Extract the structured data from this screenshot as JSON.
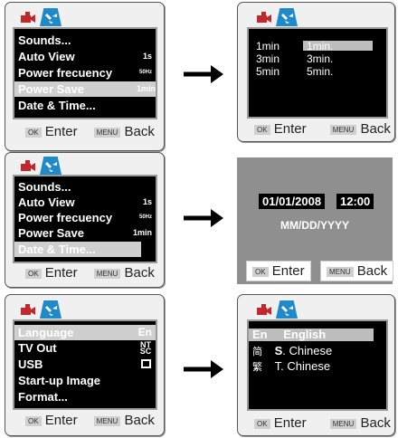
{
  "panel1": {
    "items": [
      {
        "label": "Sounds...",
        "value": ""
      },
      {
        "label": "Auto View",
        "value": "1s"
      },
      {
        "label": "Power frecuency",
        "value": "50Hz"
      },
      {
        "label": "Power Save",
        "value": "1min"
      },
      {
        "label": "Date & Time...",
        "value": ""
      }
    ],
    "enter": "Enter",
    "back": "Back",
    "ok_key": "OK",
    "menu_key": "MENU"
  },
  "panel2": {
    "left": [
      "1min",
      "3min",
      "5min"
    ],
    "right": [
      "1min.",
      "3min.",
      "5min."
    ],
    "enter": "Enter",
    "back": "Back",
    "ok_key": "OK",
    "menu_key": "MENU"
  },
  "panel3": {
    "items": [
      {
        "label": "Sounds...",
        "value": ""
      },
      {
        "label": "Auto View",
        "value": "1s"
      },
      {
        "label": "Power frecuency",
        "value": "50Hz"
      },
      {
        "label": "Power Save",
        "value": "1min"
      },
      {
        "label": "Date & Time...",
        "value": ""
      }
    ],
    "enter": "Enter",
    "back": "Back",
    "ok_key": "OK",
    "menu_key": "MENU"
  },
  "panel4": {
    "date": "01/01/2008",
    "time": "12:00",
    "format": "MM/DD/YYYY",
    "enter": "Enter",
    "back": "Back",
    "ok_key": "OK",
    "menu_key": "MENU"
  },
  "panel5": {
    "items": [
      {
        "label": "Language",
        "value": "En"
      },
      {
        "label": "TV Out",
        "value": "NT SC"
      },
      {
        "label": "USB",
        "value": ""
      },
      {
        "label": "Start-up Image",
        "value": ""
      },
      {
        "label": "Format...",
        "value": ""
      }
    ],
    "enter": "Enter",
    "back": "Back",
    "ok_key": "OK",
    "menu_key": "MENU"
  },
  "panel6": {
    "langs": [
      {
        "code": "En",
        "bold": "English",
        "rest": ""
      },
      {
        "code": "简",
        "bold": "S",
        "rest": ". Chinese"
      },
      {
        "code": "繁",
        "bold": "",
        "rest": "T. Chinese"
      }
    ],
    "enter": "Enter",
    "back": "Back",
    "ok_key": "OK",
    "menu_key": "MENU"
  }
}
